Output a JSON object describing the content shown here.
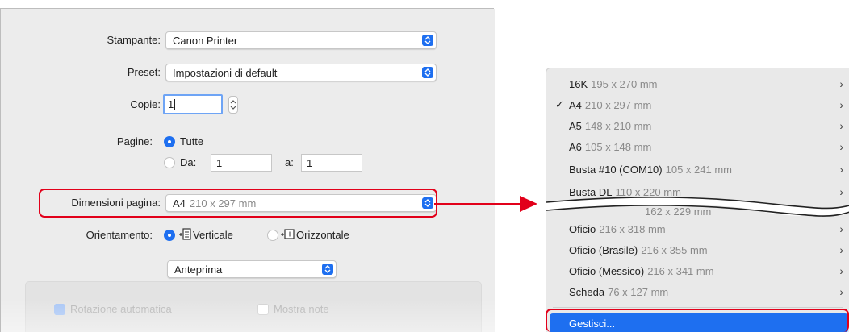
{
  "dialog": {
    "printer": {
      "label": "Stampante:",
      "value": "Canon Printer"
    },
    "preset": {
      "label": "Preset:",
      "value": "Impostazioni di default"
    },
    "copies": {
      "label": "Copie:",
      "value": "1"
    },
    "pages": {
      "label": "Pagine:",
      "all_label": "Tutte",
      "from_label": "Da:",
      "from_value": "1",
      "to_label": "a:",
      "to_value": "1"
    },
    "paper_size": {
      "label": "Dimensioni pagina:",
      "name": "A4",
      "dims": "210 x 297 mm"
    },
    "orientation": {
      "label": "Orientamento:",
      "portrait_label": "Verticale",
      "landscape_label": "Orizzontale"
    },
    "section_popup": {
      "value": "Anteprima"
    },
    "auto_rotate_label": "Rotazione automatica",
    "show_notes_label": "Mostra note"
  },
  "menu": {
    "items": [
      {
        "name": "16K",
        "dims": "195 x 270 mm",
        "checked": false
      },
      {
        "name": "A4",
        "dims": "210 x 297 mm",
        "checked": true
      },
      {
        "name": "A5",
        "dims": "148 x 210 mm",
        "checked": false
      },
      {
        "name": "A6",
        "dims": "105 x 148 mm",
        "checked": false
      },
      {
        "name": "Busta #10 (COM10)",
        "dims": "105 x 241 mm",
        "checked": false
      },
      {
        "name": "Busta DL",
        "dims": "110 x 220 mm",
        "checked": false
      },
      {
        "name": "Oficio",
        "dims": "216 x 318 mm",
        "checked": false
      },
      {
        "name": "Oficio (Brasile)",
        "dims": "216 x 355 mm",
        "checked": false
      },
      {
        "name": "Oficio (Messico)",
        "dims": "216 x 341 mm",
        "checked": false
      },
      {
        "name": "Scheda",
        "dims": "76 x 127 mm",
        "checked": false
      }
    ],
    "partial_item_dims": "162 x 229 mm",
    "check_glyph": "✓",
    "chevron_glyph": "›",
    "manage_label": "Gestisci..."
  },
  "colors": {
    "accent": "#1e6ff0",
    "highlight": "#e2001a"
  }
}
